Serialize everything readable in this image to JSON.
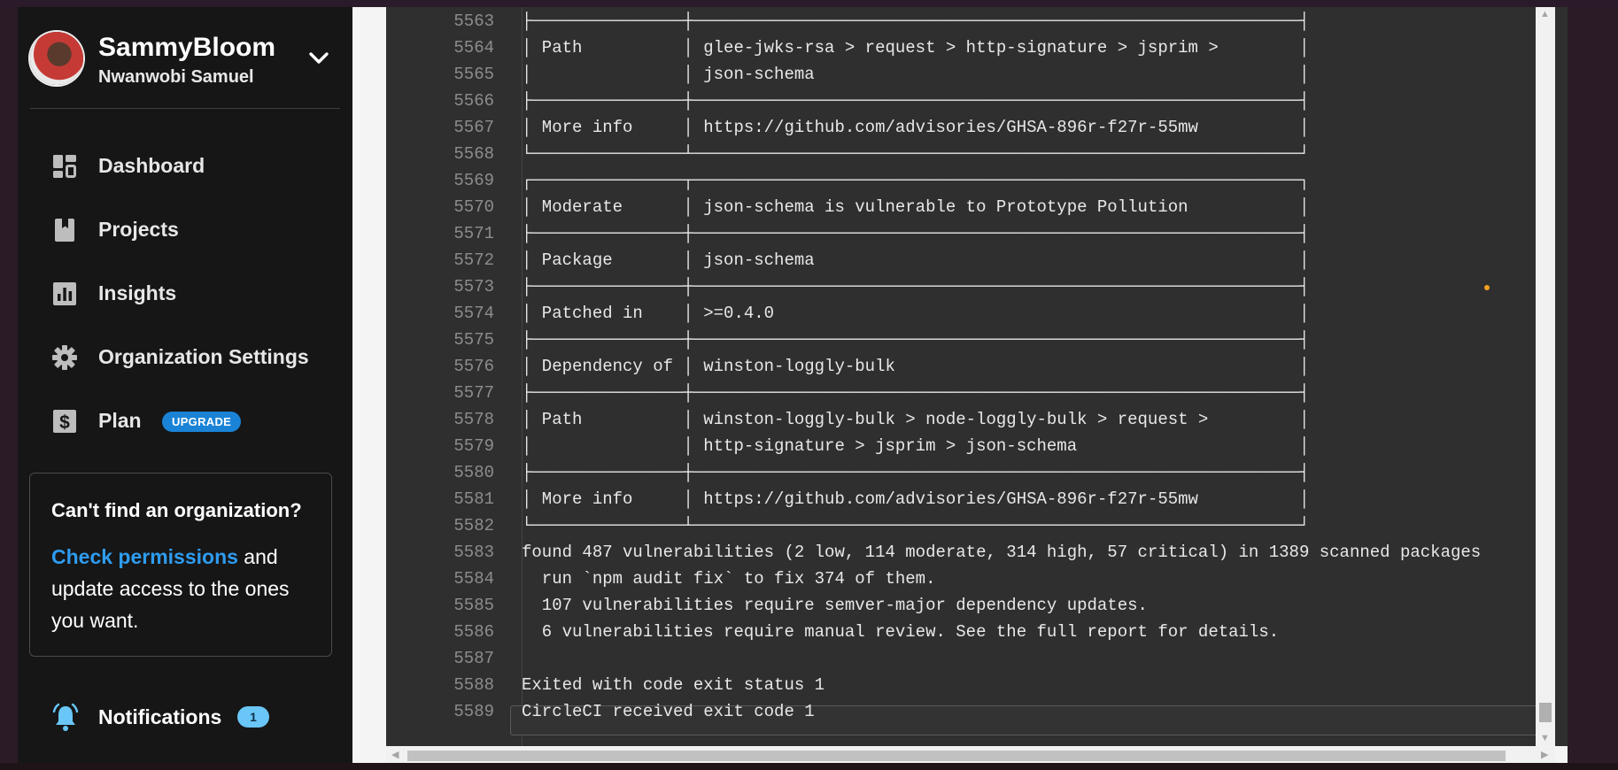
{
  "profile": {
    "username": "SammyBloom",
    "full_name": "Nwanwobi Samuel"
  },
  "nav": [
    {
      "label": "Dashboard",
      "icon": "dashboard-icon"
    },
    {
      "label": "Projects",
      "icon": "book-icon"
    },
    {
      "label": "Insights",
      "icon": "bar-chart-icon"
    },
    {
      "label": "Organization Settings",
      "icon": "gear-icon"
    },
    {
      "label": "Plan",
      "icon": "dollar-icon",
      "badge": "UPGRADE"
    }
  ],
  "org_box": {
    "title": "Can't find an organization?",
    "link": "Check permissions",
    "text": " and update access to the ones you want."
  },
  "notifications": {
    "label": "Notifications",
    "count": "1"
  },
  "colors": {
    "sidebar_bg": "#161616",
    "accent_blue": "#1a83d6",
    "link_blue": "#2e9cf0",
    "log_bg": "#2f2f2f",
    "log_text": "#e8e8e8"
  },
  "log_lines": [
    {
      "n": "5563",
      "t": "├───────────────┼────────────────────────────────────────────────────────────┤"
    },
    {
      "n": "5564",
      "t": "│ Path          │ glee-jwks-rsa > request > http-signature > jsprim >        │"
    },
    {
      "n": "5565",
      "t": "│               │ json-schema                                                │"
    },
    {
      "n": "5566",
      "t": "├───────────────┼────────────────────────────────────────────────────────────┤"
    },
    {
      "n": "5567",
      "t": "│ More info     │ https://github.com/advisories/GHSA-896r-f27r-55mw          │"
    },
    {
      "n": "5568",
      "t": "└───────────────┴────────────────────────────────────────────────────────────┘"
    },
    {
      "n": "5569",
      "t": "┌───────────────┬────────────────────────────────────────────────────────────┐"
    },
    {
      "n": "5570",
      "t": "│ Moderate      │ json-schema is vulnerable to Prototype Pollution           │"
    },
    {
      "n": "5571",
      "t": "├───────────────┼────────────────────────────────────────────────────────────┤"
    },
    {
      "n": "5572",
      "t": "│ Package       │ json-schema                                                │"
    },
    {
      "n": "5573",
      "t": "├───────────────┼────────────────────────────────────────────────────────────┤"
    },
    {
      "n": "5574",
      "t": "│ Patched in    │ >=0.4.0                                                    │"
    },
    {
      "n": "5575",
      "t": "├───────────────┼────────────────────────────────────────────────────────────┤"
    },
    {
      "n": "5576",
      "t": "│ Dependency of │ winston-loggly-bulk                                        │"
    },
    {
      "n": "5577",
      "t": "├───────────────┼────────────────────────────────────────────────────────────┤"
    },
    {
      "n": "5578",
      "t": "│ Path          │ winston-loggly-bulk > node-loggly-bulk > request >         │"
    },
    {
      "n": "5579",
      "t": "│               │ http-signature > jsprim > json-schema                      │"
    },
    {
      "n": "5580",
      "t": "├───────────────┼────────────────────────────────────────────────────────────┤"
    },
    {
      "n": "5581",
      "t": "│ More info     │ https://github.com/advisories/GHSA-896r-f27r-55mw          │"
    },
    {
      "n": "5582",
      "t": "└───────────────┴────────────────────────────────────────────────────────────┘"
    },
    {
      "n": "5583",
      "t": "found 487 vulnerabilities (2 low, 114 moderate, 314 high, 57 critical) in 1389 scanned packages"
    },
    {
      "n": "5584",
      "t": "  run `npm audit fix` to fix 374 of them."
    },
    {
      "n": "5585",
      "t": "  107 vulnerabilities require semver-major dependency updates."
    },
    {
      "n": "5586",
      "t": "  6 vulnerabilities require manual review. See the full report for details."
    },
    {
      "n": "5587",
      "t": ""
    },
    {
      "n": "5588",
      "t": "Exited with code exit status 1"
    },
    {
      "n": "5589",
      "t": "CircleCI received exit code 1"
    }
  ]
}
